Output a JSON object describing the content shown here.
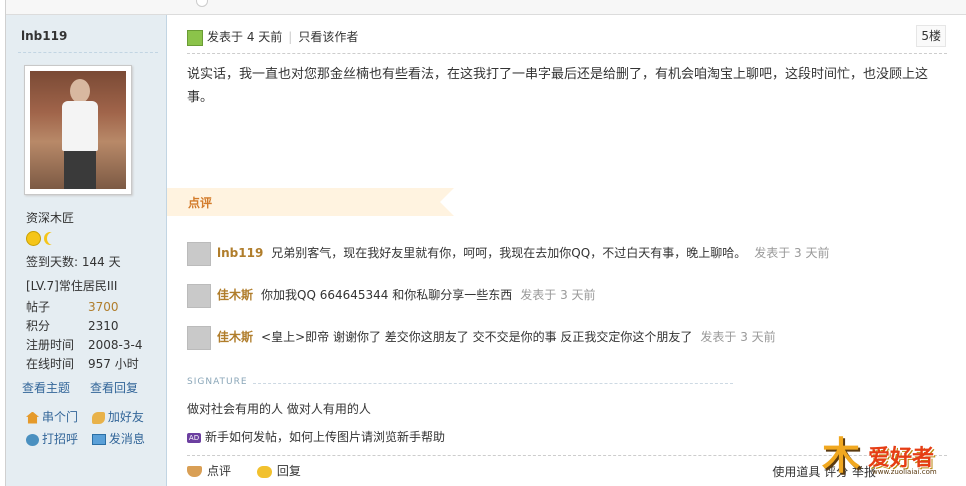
{
  "sidebar": {
    "author": "lnb119",
    "rank": "资深木匠",
    "signin": "签到天数: 144 天",
    "level": "[LV.7]常住居民III",
    "stats": [
      {
        "label": "帖子",
        "value": "3700"
      },
      {
        "label": "积分",
        "value": "2310"
      },
      {
        "label": "注册时间",
        "value": "2008-3-4"
      },
      {
        "label": "在线时间",
        "value": "957 小时"
      }
    ],
    "links": {
      "topics": "查看主题",
      "replies": "查看回复"
    },
    "actions": {
      "visit": "串个门",
      "add_friend": "加好友",
      "poke": "打招呼",
      "message": "发消息"
    }
  },
  "post": {
    "posted_time": "发表于 4 天前",
    "only_author": "只看该作者",
    "floor": "5楼",
    "content": "说实话，我一直也对您那金丝楠也有些看法，在这我打了一串字最后还是给删了，有机会咱淘宝上聊吧，这段时间忙，也没顾上这事。",
    "comment_label": "点评",
    "comments": [
      {
        "author": "lnb119",
        "text": "兄弟别客气，现在我好友里就有你，呵呵，我现在去加你QQ，不过白天有事，晚上聊哈。",
        "time": "发表于 3 天前"
      },
      {
        "author": "佳木斯",
        "text": "你加我QQ 664645344 和你私聊分享一些东西",
        "time": "发表于 3 天前"
      },
      {
        "author": "佳木斯",
        "text": "<皇上>即帝 谢谢你了 差交你这朋友了 交不交是你的事 反正我交定你这个朋友了",
        "time": "发表于 3 天前"
      }
    ],
    "signature_label": "SIGNATURE",
    "signature": "做对社会有用的人  做对人有用的人",
    "newbie_badge": "AD",
    "newbie_link": "新手如何发帖，如何上传图片请浏览新手帮助",
    "footer": {
      "comment": "点评",
      "reply": "回复",
      "right": "使用道具   评分   举报"
    }
  },
  "logo": {
    "glyph": "木",
    "title": "爱好者",
    "url": "www.zuoliaiai.com"
  },
  "colors": {
    "sidebar_bg": "#e5edf2",
    "author_link": "#b07d2b",
    "link": "#336699",
    "comment_tab": "#fff3e0"
  }
}
